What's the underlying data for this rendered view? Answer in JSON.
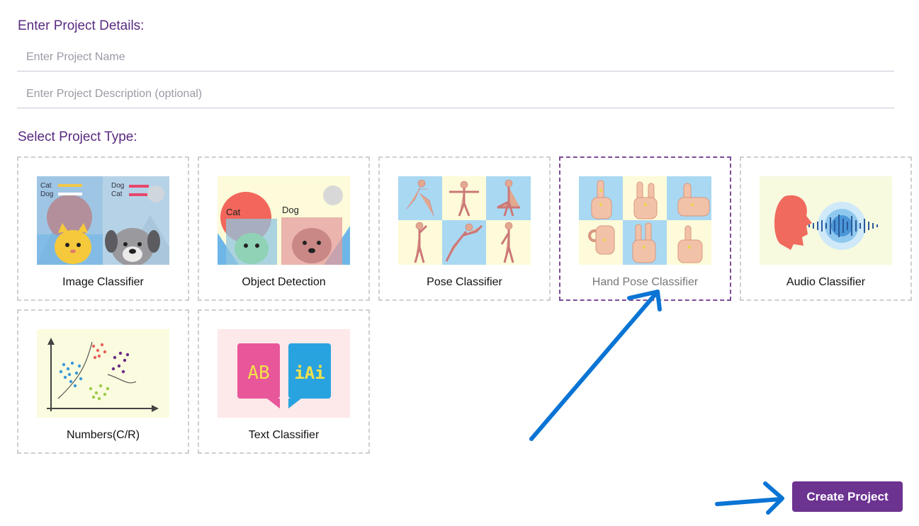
{
  "details": {
    "title": "Enter Project Details:",
    "name_placeholder": "Enter Project Name",
    "description_placeholder": "Enter Project Description (optional)"
  },
  "project_type": {
    "title": "Select Project Type:",
    "cards": [
      {
        "label": "Image Classifier",
        "icon": "image-classifier-thumbnail",
        "selected": false
      },
      {
        "label": "Object Detection",
        "icon": "object-detection-thumbnail",
        "selected": false
      },
      {
        "label": "Pose Classifier",
        "icon": "pose-classifier-thumbnail",
        "selected": false
      },
      {
        "label": "Hand Pose Classifier",
        "icon": "hand-pose-thumbnail",
        "selected": true
      },
      {
        "label": "Audio Classifier",
        "icon": "audio-classifier-thumbnail",
        "selected": false
      },
      {
        "label": "Numbers(C/R)",
        "icon": "numbers-thumbnail",
        "selected": false
      },
      {
        "label": "Text Classifier",
        "icon": "text-classifier-thumbnail",
        "selected": false
      }
    ],
    "thumb_text": {
      "cat": "Cat",
      "dog": "Dog",
      "bubble_left": "AB",
      "bubble_right": "iAi"
    }
  },
  "actions": {
    "create_label": "Create Project"
  },
  "colors": {
    "accent": "#6c3391",
    "title": "#5a2a80",
    "annotation_arrow": "#0a74d4"
  }
}
